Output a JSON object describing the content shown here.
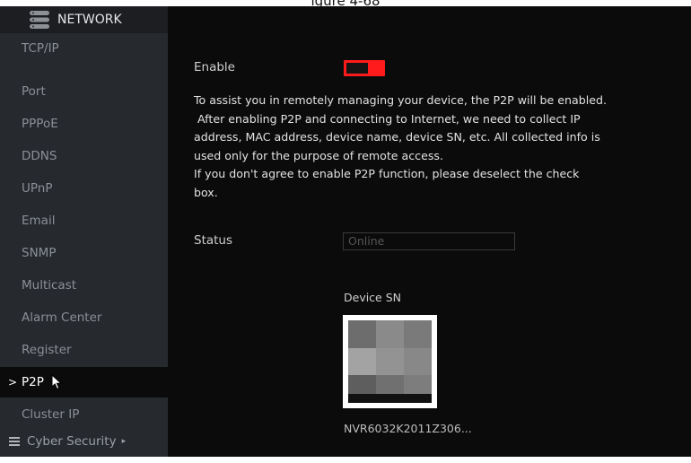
{
  "caption": "igure 4-68",
  "sidebar": {
    "title": "NETWORK",
    "items": [
      {
        "label": "TCP/IP"
      },
      {
        "label": "Port"
      },
      {
        "label": "PPPoE"
      },
      {
        "label": "DDNS"
      },
      {
        "label": "UPnP"
      },
      {
        "label": "Email"
      },
      {
        "label": "SNMP"
      },
      {
        "label": "Multicast"
      },
      {
        "label": "Alarm Center"
      },
      {
        "label": "Register"
      },
      {
        "label": "P2P"
      },
      {
        "label": "Cluster IP"
      }
    ],
    "active_item": "P2P",
    "active_marker": ">",
    "footer_label": "Cyber Security",
    "footer_arrow": "▸"
  },
  "p2p": {
    "enable_label": "Enable",
    "enable_on": true,
    "notice_lines": [
      "To assist you in remotely managing your device, the P2P will be enabled.",
      " After enabling P2P and connecting to Internet, we need to collect IP",
      "address, MAC address, device name, device SN, etc. All collected info is",
      "used only for the purpose of remote access.",
      "If you don't agree to enable P2P function, please deselect the check",
      "box."
    ],
    "status_label": "Status",
    "status_value": "Online",
    "device_sn_label": "Device SN",
    "device_sn_value": "NVR6032K2011Z306..."
  },
  "colors": {
    "toggle_on": "#ff1b1b",
    "sidebar_bg": "#26292e",
    "main_bg": "#0b0b0b"
  },
  "icons": {
    "header": "network-icon",
    "cursor": "mouse-pointer-icon",
    "footer": "list-icon"
  }
}
